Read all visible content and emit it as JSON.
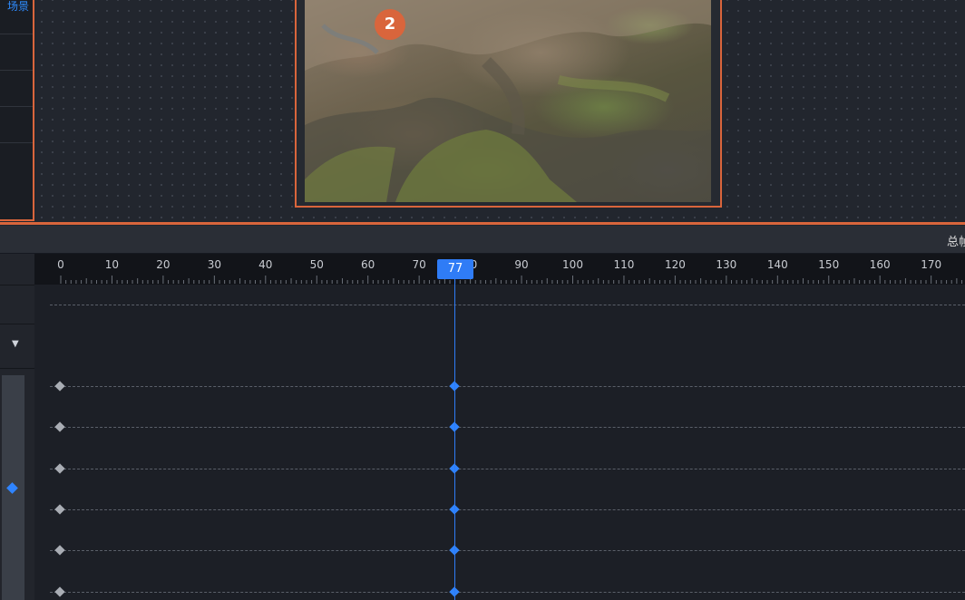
{
  "scene_panel": {
    "link_label": "场景"
  },
  "viewport": {
    "step_badge": "2"
  },
  "timeline_header": {
    "total_label": "总帧"
  },
  "ruler": {
    "ticks": [
      "0",
      "10",
      "20",
      "30",
      "40",
      "50",
      "60",
      "70",
      "80",
      "90",
      "100",
      "110",
      "120",
      "130",
      "140",
      "150",
      "160",
      "170"
    ]
  },
  "playhead": {
    "frame": "77"
  },
  "tracks": {
    "count": 6
  },
  "colors": {
    "accent": "#d9653c",
    "highlight": "#2f7cf6"
  }
}
